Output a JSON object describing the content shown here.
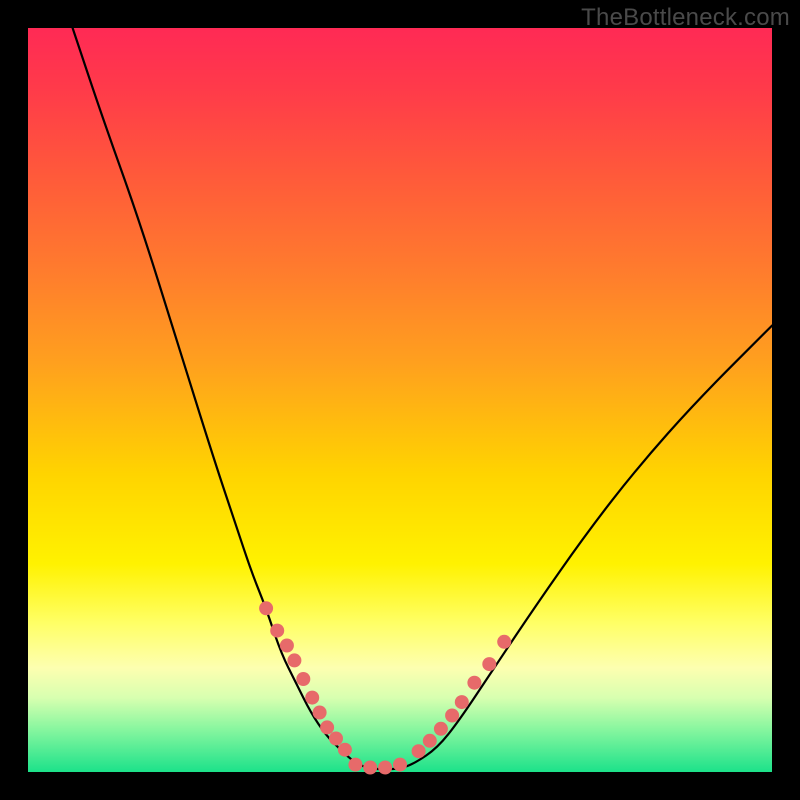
{
  "watermark": "TheBottleneck.com",
  "chart_data": {
    "type": "line",
    "title": "",
    "xlabel": "",
    "ylabel": "",
    "xlim": [
      0,
      100
    ],
    "ylim": [
      0,
      100
    ],
    "grid": false,
    "legend": false,
    "series": [
      {
        "name": "bottleneck-curve",
        "x": [
          6,
          10,
          15,
          20,
          25,
          28,
          30,
          32,
          34,
          36,
          38,
          40,
          42,
          44,
          46,
          48,
          50,
          52,
          55,
          58,
          62,
          68,
          75,
          82,
          90,
          100
        ],
        "y": [
          100,
          88,
          74,
          58,
          42,
          33,
          27,
          22,
          16,
          12,
          8,
          5,
          3,
          1.2,
          0.4,
          0.4,
          0.4,
          1.2,
          3.2,
          7,
          13,
          22,
          32,
          41,
          50,
          60
        ]
      }
    ],
    "markers": [
      {
        "name": "left-cluster",
        "x_approx": [
          32,
          33.5,
          34.8,
          35.8,
          37,
          38.2,
          39.2,
          40.2,
          41.4,
          42.6
        ],
        "y_approx": [
          22,
          19,
          17,
          15,
          12.5,
          10,
          8,
          6,
          4.5,
          3.0
        ]
      },
      {
        "name": "bottom-cluster",
        "x_approx": [
          44,
          46,
          48,
          50
        ],
        "y_approx": [
          1.0,
          0.6,
          0.6,
          1.0
        ]
      },
      {
        "name": "right-cluster",
        "x_approx": [
          52.5,
          54,
          55.5,
          57,
          58.3,
          60,
          62,
          64
        ],
        "y_approx": [
          2.8,
          4.2,
          5.8,
          7.6,
          9.4,
          12,
          14.5,
          17.5
        ]
      }
    ],
    "background_gradient": {
      "type": "vertical",
      "stops": [
        {
          "pos": 0.0,
          "color": "#ff2a55"
        },
        {
          "pos": 0.2,
          "color": "#ff5a3a"
        },
        {
          "pos": 0.45,
          "color": "#ffa01e"
        },
        {
          "pos": 0.72,
          "color": "#fff200"
        },
        {
          "pos": 0.9,
          "color": "#d8ffb0"
        },
        {
          "pos": 1.0,
          "color": "#1ce28a"
        }
      ]
    }
  }
}
